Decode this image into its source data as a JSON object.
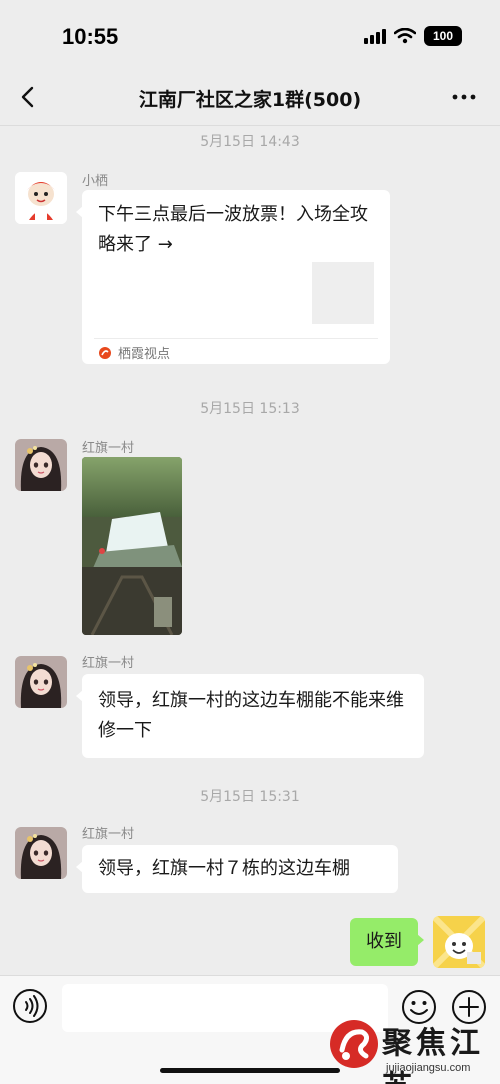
{
  "status_bar": {
    "time": "10:55",
    "battery": "100"
  },
  "nav": {
    "title": "江南厂社区之家1群(500)"
  },
  "messages": [
    {
      "type": "timestamp",
      "text": "5月15日 14:43"
    },
    {
      "type": "card",
      "sender": "小栖",
      "title": "下午三点最后一波放票！入场全攻略来了 →",
      "source": "栖霞视点"
    },
    {
      "type": "timestamp",
      "text": "5月15日 15:13"
    },
    {
      "type": "image",
      "sender": "红旗一村"
    },
    {
      "type": "text",
      "sender": "红旗一村",
      "text": "领导，红旗一村的这边车棚能不能来维修一下"
    },
    {
      "type": "timestamp",
      "text": "5月15日 15:31"
    },
    {
      "type": "text",
      "sender": "红旗一村",
      "text": "领导，红旗一村７栋的这边车棚"
    },
    {
      "type": "self",
      "text": "收到"
    }
  ],
  "watermark": {
    "cn": "聚焦江苏",
    "en": "jujiaojiangsu.com"
  },
  "icons": {
    "back": "chevron-left-icon",
    "more": "ellipsis-icon",
    "voice": "voice-icon",
    "emoji": "smiley-icon",
    "add": "plus-icon"
  },
  "colors": {
    "self_bubble": "#95ec69",
    "background": "#ededed",
    "source_logo": "#e8491d"
  }
}
